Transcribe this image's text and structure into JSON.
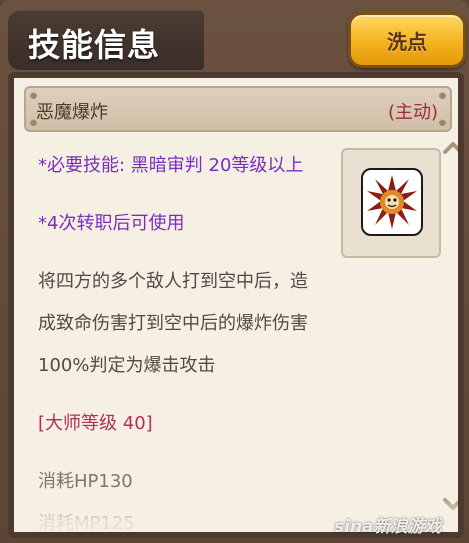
{
  "header": {
    "title": "技能信息",
    "reset_label": "洗点"
  },
  "skill": {
    "name": "恶魔爆炸",
    "type": "(主动)",
    "requirement": "*必要技能: 黑暗审判 20等级以上",
    "job_requirement": "*4次转职后可使用",
    "description_lines": [
      "将四方的多个敌人打到空中后，造",
      "成致命伤害打到空中后的爆炸伤害",
      "100%判定为爆击攻击"
    ],
    "master_level": "[大师等级 40]",
    "hp_cost": "消耗HP130",
    "mp_cost": "消耗MP125",
    "icon": "demon-explosion-icon"
  },
  "watermark": "sina新浪游戏",
  "colors": {
    "requirement": "#7b2fc0",
    "master_level": "#b0305a",
    "skill_type": "#a02a3a",
    "button": "#f3b21d"
  }
}
